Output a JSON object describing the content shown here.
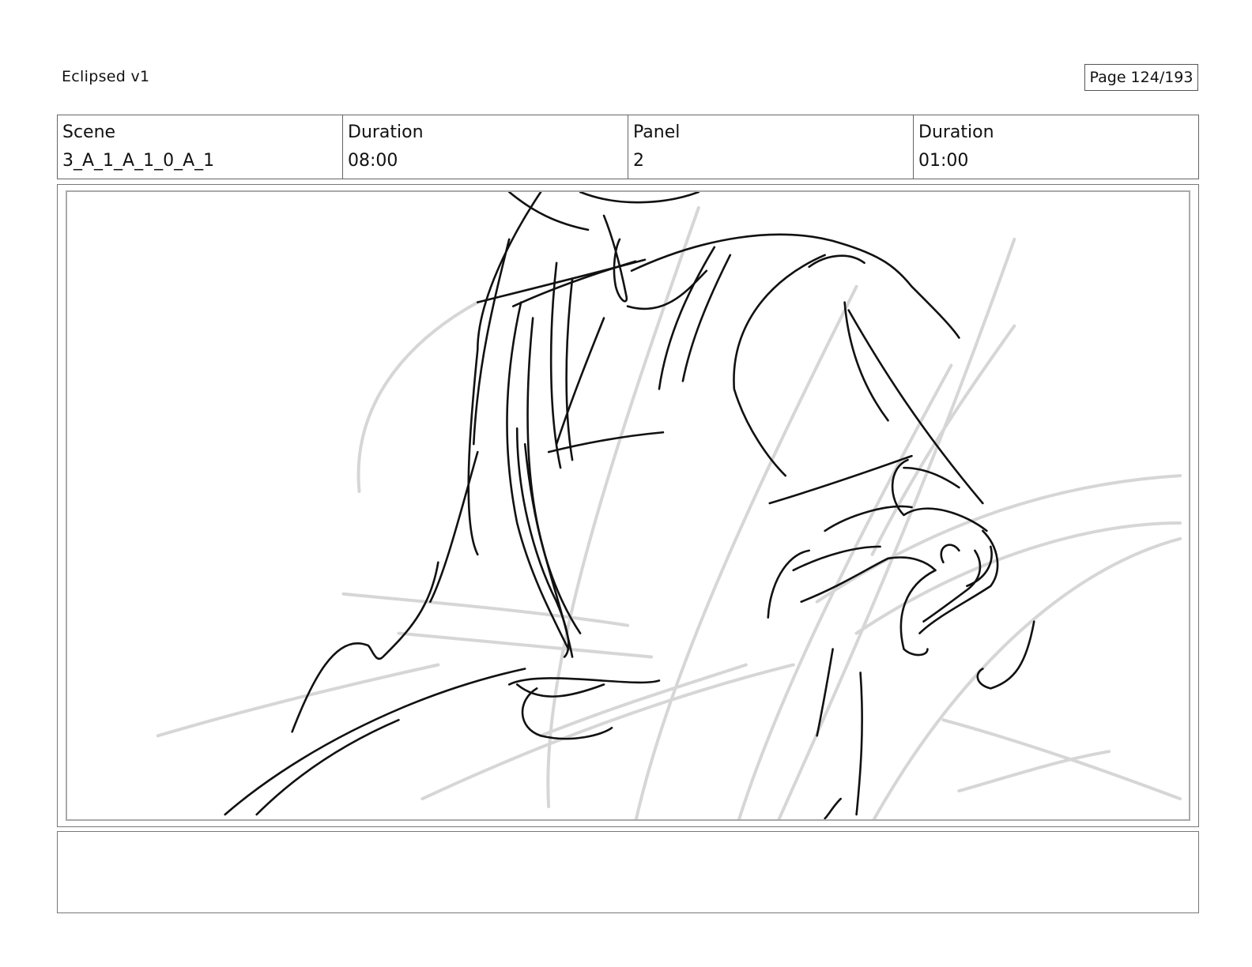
{
  "document": {
    "title": "Eclipsed v1",
    "page": "Page 124/193"
  },
  "info": {
    "scene_label": "Scene",
    "scene_value": "3_A_1_A_1_0_A_1",
    "scene_duration_label": "Duration",
    "scene_duration_value": "08:00",
    "panel_label": "Panel",
    "panel_value": "2",
    "panel_duration_label": "Duration",
    "panel_duration_value": "01:00"
  },
  "panel": {
    "image": "sketch-figure-leaning-on-surface"
  },
  "notes": {
    "text": ""
  }
}
